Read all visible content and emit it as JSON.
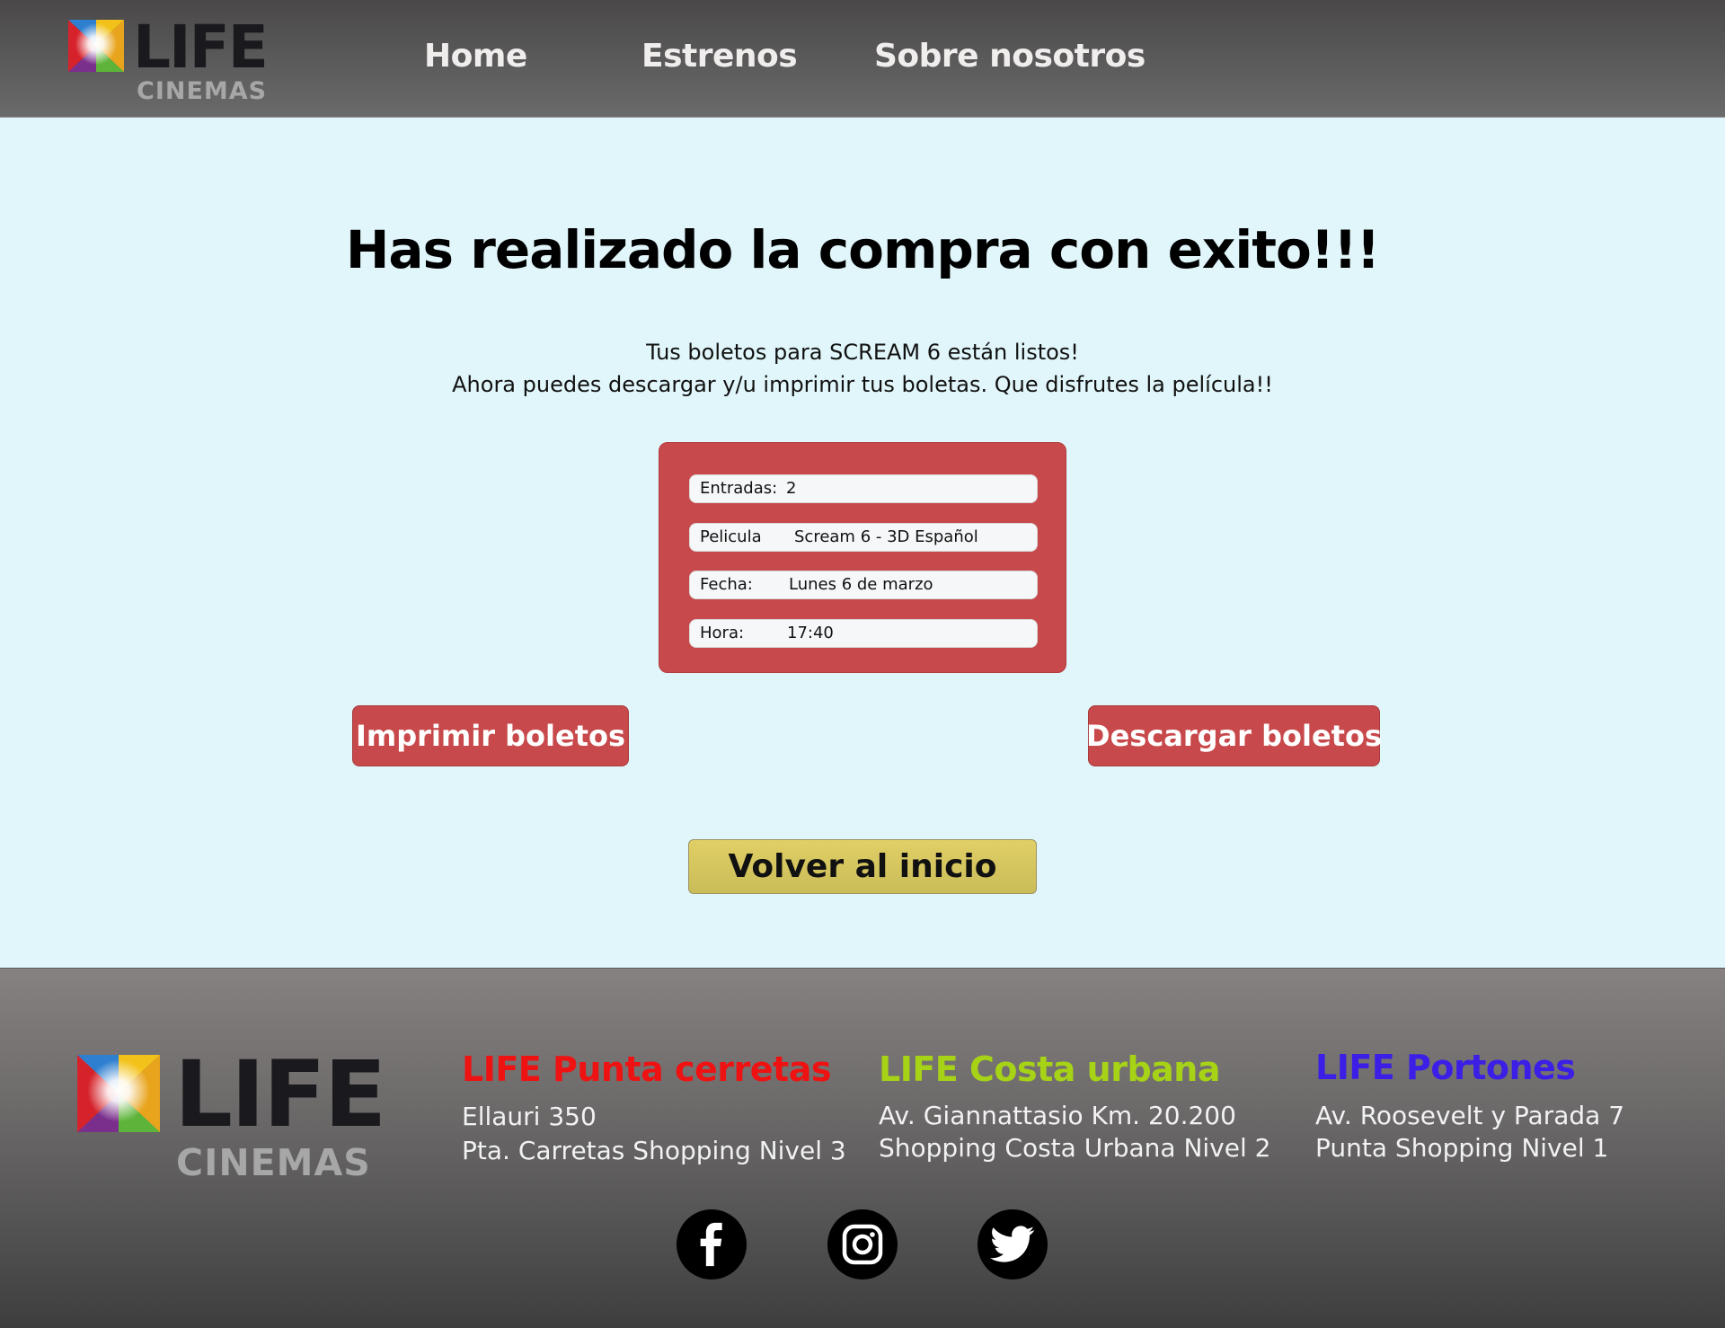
{
  "header": {
    "logo": {
      "word": "LIFE",
      "sub": "CINEMAS"
    },
    "nav": [
      {
        "label": "Home"
      },
      {
        "label": "Estrenos"
      },
      {
        "label": "Sobre nosotros"
      }
    ]
  },
  "main": {
    "title": "Has realizado la compra con exito!!!",
    "subtitle_line1": "Tus boletos para SCREAM 6 están listos!",
    "subtitle_line2": "Ahora puedes descargar y/u imprimir tus boletas. Que disfrutes la película!!",
    "ticket": {
      "rows": [
        {
          "label": "Entradas:",
          "value": "2"
        },
        {
          "label": "Pelicula",
          "value": "Scream 6 -  3D Español"
        },
        {
          "label": "Fecha:",
          "value": "Lunes 6 de marzo"
        },
        {
          "label": "Hora:",
          "value": "17:40"
        }
      ]
    },
    "print_button": "Imprimir boletos",
    "download_button": "Descargar boletos",
    "home_button": "Volver al inicio"
  },
  "footer": {
    "logo": {
      "word": "LIFE",
      "sub": "CINEMAS"
    },
    "branches": [
      {
        "name": "LIFE Punta cerretas",
        "line1": "Ellauri 350",
        "line2": "Pta. Carretas Shopping Nivel 3",
        "color": "#ee1212"
      },
      {
        "name": "LIFE Costa urbana",
        "line1": "Av. Giannattasio Km. 20.200",
        "line2": "Shopping Costa Urbana Nivel 2",
        "color": "#a6d316"
      },
      {
        "name": "LIFE Portones",
        "line1": "Av. Roosevelt y Parada 7",
        "line2": "Punta Shopping Nivel 1",
        "color": "#3b1fe6"
      }
    ],
    "social": [
      {
        "icon": "facebook-icon"
      },
      {
        "icon": "instagram-icon"
      },
      {
        "icon": "twitter-icon"
      }
    ]
  },
  "colors": {
    "accent_red": "#c8494b",
    "home_button": "#d8c860",
    "page_background": "#e1f6fa"
  }
}
